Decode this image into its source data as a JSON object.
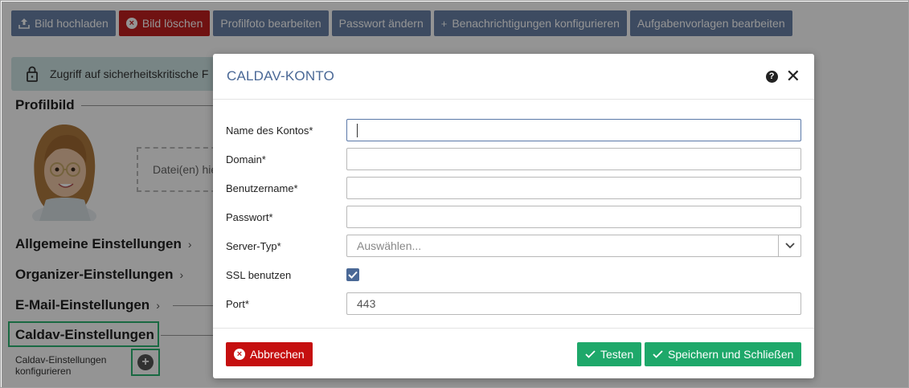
{
  "toolbar": {
    "buttons": [
      {
        "label": "Bild hochladen",
        "icon": "upload-icon"
      },
      {
        "label": "Bild löschen",
        "icon": "x-circle-icon"
      },
      {
        "label": "Profilfoto bearbeiten"
      },
      {
        "label": "Passwort ändern"
      },
      {
        "label": "Benachrichtigungen konfigurieren",
        "icon": "plus-icon"
      },
      {
        "label": "Aufgabenvorlagen bearbeiten"
      }
    ]
  },
  "background": {
    "info_text": "Zugriff auf sicherheitskritische F",
    "profilbild_title": "Profilbild",
    "dropzone_text": "Datei(en) hie",
    "sections": [
      {
        "label": "Allgemeine Einstellungen"
      },
      {
        "label": "Organizer-Einstellungen"
      },
      {
        "label": "E-Mail-Einstellungen"
      },
      {
        "label": "Caldav-Einstellungen"
      }
    ],
    "caldav_sub": "Caldav-Einstellungen konfigurieren"
  },
  "modal": {
    "title": "CALDAV-KONTO",
    "fields": [
      {
        "label": "Name des Kontos*",
        "value": ""
      },
      {
        "label": "Domain*",
        "value": ""
      },
      {
        "label": "Benutzername*",
        "value": ""
      },
      {
        "label": "Passwort*",
        "value": ""
      },
      {
        "label": "Server-Typ*",
        "placeholder": "Auswählen..."
      },
      {
        "label": "SSL benutzen",
        "checked": true
      },
      {
        "label": "Port*",
        "value": "443"
      }
    ],
    "cancel_label": "Abbrechen",
    "test_label": "Testen",
    "save_label": "Speichern und Schließen"
  },
  "colors": {
    "primary": "#6a82a8",
    "danger": "#c21f1f",
    "success": "#1ea86a",
    "title": "#4a6896",
    "highlight": "#2bb673"
  }
}
